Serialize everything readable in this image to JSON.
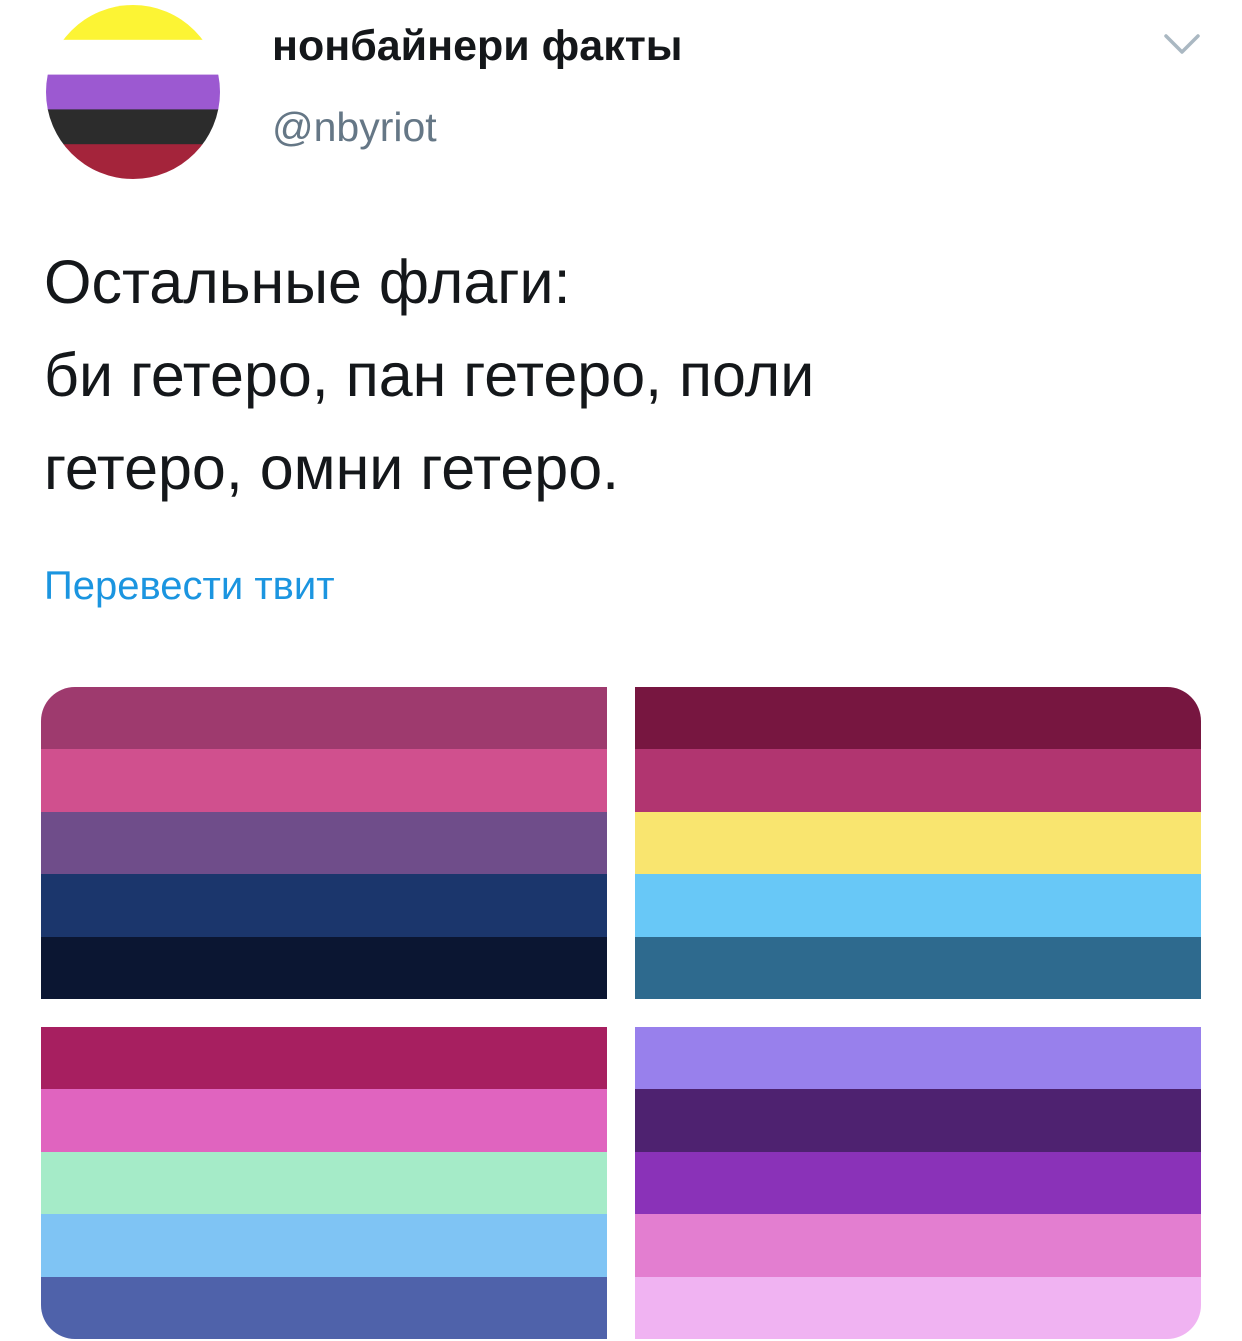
{
  "tweet": {
    "display_name": "нонбайнери факты",
    "handle": "@nbyriot",
    "text_lines": [
      "Остальные флаги:",
      "би гетеро, пан гетеро, поли",
      "гетеро, омни гетеро."
    ],
    "translate_label": "Перевести твит",
    "menu_icon": "chevron-down-icon",
    "avatar_colors": [
      "#fcf434",
      "#ffffff",
      "#9c59d1",
      "#2c2c2c",
      "#a4243b"
    ]
  },
  "media": {
    "flags": [
      {
        "name": "flag-bi-hetero",
        "stripes": [
          "#9e3a6e",
          "#d0508e",
          "#6f4d8a",
          "#1b366c",
          "#0b1632"
        ]
      },
      {
        "name": "flag-pan-hetero",
        "stripes": [
          "#771640",
          "#b13570",
          "#f9e56f",
          "#68c8f7",
          "#2e6a8e"
        ]
      },
      {
        "name": "flag-poly-hetero",
        "stripes": [
          "#a71f60",
          "#e064bf",
          "#a5ebc8",
          "#7fc4f4",
          "#4f62aa"
        ]
      },
      {
        "name": "flag-omni-hetero",
        "stripes": [
          "#9880ec",
          "#4e2270",
          "#8a32b8",
          "#e37ed0",
          "#f0b3f2"
        ]
      }
    ]
  }
}
